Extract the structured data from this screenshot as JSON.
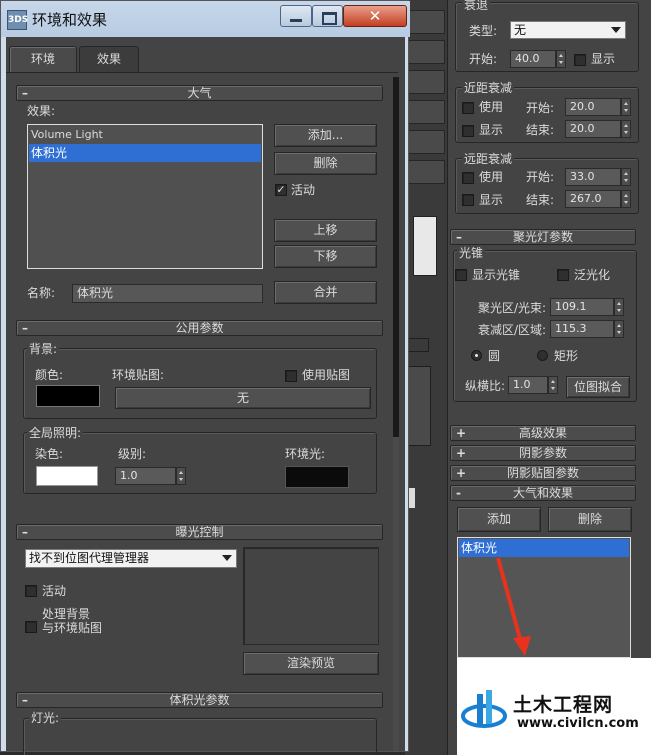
{
  "dialog": {
    "title": "环境和效果",
    "icon_text": "3DS",
    "close_glyph": "✕",
    "tabs": [
      {
        "label": "环境",
        "active": true
      },
      {
        "label": "效果",
        "active": false
      }
    ],
    "atmosphere": {
      "header": "大气",
      "effects_label": "效果:",
      "list_items": [
        "Volume Light",
        "体积光"
      ],
      "selected_index": 1,
      "add_button": "添加...",
      "delete_button": "删除",
      "active_label": "活动",
      "active_checked": true,
      "move_up_button": "上移",
      "move_down_button": "下移",
      "name_label": "名称:",
      "name_value": "体积光",
      "merge_button": "合并"
    },
    "common": {
      "header": "公用参数",
      "background_group": "背景:",
      "color_label": "颜色:",
      "env_map_label": "环境贴图:",
      "use_map_label": "使用贴图",
      "use_map_checked": false,
      "env_map_button": "无",
      "background_color": "#000000",
      "global_lighting_group": "全局照明:",
      "tint_label": "染色:",
      "tint_color": "#ffffff",
      "level_label": "级别:",
      "level_value": "1.0",
      "ambient_label": "环境光:",
      "ambient_color": "#0b0b0b"
    },
    "exposure": {
      "header": "曝光控制",
      "selected": "找不到位图代理管理器",
      "active_label": "活动",
      "process_bg_label_line1": "处理背景",
      "process_bg_label_line2": "与环境贴图",
      "render_preview_button": "渲染预览"
    },
    "volume_light": {
      "header": "体积光参数",
      "lights_group": "灯光:"
    }
  },
  "right_panel": {
    "decay": {
      "group": "衰退",
      "type_label": "类型:",
      "type_value": "无",
      "start_label": "开始:",
      "start_value": "40.0",
      "show_label": "显示"
    },
    "near_atten": {
      "group": "近距衰减",
      "use_label": "使用",
      "show_label": "显示",
      "start_label": "开始:",
      "start_value": "20.0",
      "end_label": "结束:",
      "end_value": "20.0"
    },
    "far_atten": {
      "group": "远距衰减",
      "use_label": "使用",
      "show_label": "显示",
      "start_label": "开始:",
      "start_value": "33.0",
      "end_label": "结束:",
      "end_value": "267.0"
    },
    "spotlight": {
      "header": "聚光灯参数",
      "cone_group": "光锥",
      "show_cone_label": "显示光锥",
      "overshoot_label": "泛光化",
      "hotspot_label": "聚光区/光束:",
      "hotspot_value": "109.1",
      "falloff_label": "衰减区/区域:",
      "falloff_value": "115.3",
      "circle_label": "圆",
      "rect_label": "矩形",
      "circle_selected": true,
      "aspect_label": "纵横比:",
      "aspect_value": "1.0",
      "bitmap_fit_button": "位图拟合"
    },
    "rollouts": [
      {
        "sign": "+",
        "label": "高级效果"
      },
      {
        "sign": "+",
        "label": "阴影参数"
      },
      {
        "sign": "+",
        "label": "阴影贴图参数"
      },
      {
        "sign": "-",
        "label": "大气和效果"
      }
    ],
    "atm_effects": {
      "add_button": "添加",
      "delete_button": "删除",
      "list_items": [
        "体积光"
      ]
    }
  },
  "watermark": {
    "name": "土木工程网",
    "url": "www.civilcn.com"
  },
  "colors": {
    "selection": "#2f6fd4",
    "arrow": "#e8321e"
  }
}
